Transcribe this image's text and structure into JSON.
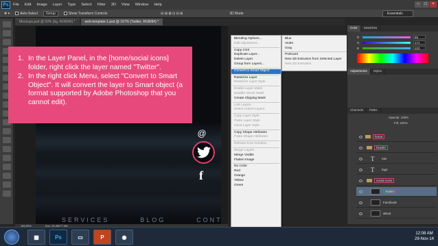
{
  "app": {
    "logo": "Ps"
  },
  "menubar": [
    "File",
    "Edit",
    "Image",
    "Layer",
    "Type",
    "Select",
    "Filter",
    "3D",
    "View",
    "Window",
    "Help"
  ],
  "options": {
    "auto_select": "Auto-Select",
    "group": "Group",
    "show_transform": "Show Transform Controls",
    "mode_3d": "3D Mode",
    "workspace": "Essentials"
  },
  "tabs": [
    {
      "label": "Mockups.psd @ 50% (bg, RGB/8#) *"
    },
    {
      "label": "web-template-1.psd @ 167% (Twitter, RGB/8#) *"
    }
  ],
  "instructions": [
    {
      "num": "1.",
      "text": "In the Layer Panel, in the [home/social icons] folder, right click the layer named \"Twitter\"."
    },
    {
      "num": "2.",
      "text": "In the right click Menu, select \"Convert to Smart Object\". It will convert the layer to Smart object (a format supported by Adobe Photoshop that you cannot edit)."
    }
  ],
  "artwork": {
    "nav": [
      "SERVICES",
      "BLOG",
      "CONTACT"
    ],
    "at_symbol": "@",
    "fb_letter": "f"
  },
  "context_menu": [
    {
      "label": "Blending Options...",
      "state": "normal"
    },
    {
      "label": "Edit Adjustment...",
      "state": "disabled"
    },
    {
      "sep": true
    },
    {
      "label": "Copy CSS",
      "state": "normal"
    },
    {
      "label": "Duplicate Layer...",
      "state": "normal"
    },
    {
      "label": "Delete Layer",
      "state": "normal"
    },
    {
      "label": "Group from Layers...",
      "state": "normal"
    },
    {
      "sep": true
    },
    {
      "label": "Convert to Smart Object",
      "state": "highlight"
    },
    {
      "sep": true
    },
    {
      "label": "Rasterize Layer",
      "state": "normal"
    },
    {
      "label": "Rasterize Layer Style",
      "state": "disabled"
    },
    {
      "sep": true
    },
    {
      "label": "Enable Layer Mask",
      "state": "disabled"
    },
    {
      "label": "Disable Vector Mask",
      "state": "disabled"
    },
    {
      "label": "Create Clipping Mask",
      "state": "normal"
    },
    {
      "sep": true
    },
    {
      "label": "Link Layers",
      "state": "disabled"
    },
    {
      "label": "Select Linked Layers",
      "state": "disabled"
    },
    {
      "sep": true
    },
    {
      "label": "Copy Layer Style",
      "state": "disabled"
    },
    {
      "label": "Paste Layer Style",
      "state": "disabled"
    },
    {
      "label": "Clear Layer Style",
      "state": "disabled"
    },
    {
      "sep": true
    },
    {
      "label": "Copy Shape Attributes",
      "state": "normal"
    },
    {
      "label": "Paste Shape Attributes",
      "state": "disabled"
    },
    {
      "sep": true
    },
    {
      "label": "Release from Isolation",
      "state": "disabled"
    },
    {
      "sep": true
    },
    {
      "label": "Merge Layers",
      "state": "disabled"
    },
    {
      "label": "Merge Visible",
      "state": "normal"
    },
    {
      "label": "Flatten Image",
      "state": "normal"
    },
    {
      "sep": true
    },
    {
      "label": "No Color",
      "state": "normal"
    },
    {
      "label": "Red",
      "state": "normal"
    },
    {
      "label": "Orange",
      "state": "normal"
    },
    {
      "label": "Yellow",
      "state": "normal"
    },
    {
      "label": "Green",
      "state": "normal"
    }
  ],
  "context_menu_2": [
    {
      "label": "Blue",
      "state": "normal"
    },
    {
      "label": "Violet",
      "state": "normal"
    },
    {
      "label": "Gray",
      "state": "normal"
    },
    {
      "sep": true
    },
    {
      "label": "Postcard",
      "state": "normal"
    },
    {
      "label": "New 3D Extrusion from Selected Layer",
      "state": "normal"
    },
    {
      "label": "New 3D Extrusion",
      "state": "disabled"
    }
  ],
  "panels": {
    "color_tabs": [
      "Color",
      "Swatches"
    ],
    "sliders": [
      {
        "label": "R",
        "value": "69"
      },
      {
        "label": "G",
        "value": "171"
      },
      {
        "label": "B",
        "value": "223"
      }
    ],
    "adjust_tabs": [
      "Adjustments",
      "Styles"
    ],
    "layer_tabs": [
      "Channels",
      "Paths"
    ],
    "opacity": "Opacity: 100%",
    "fill": "Fill: 100%"
  },
  "layers": [
    {
      "name": "home",
      "type": "folder",
      "selected": false
    },
    {
      "name": "header",
      "type": "folder",
      "selected": false
    },
    {
      "name": "nav",
      "type": "text",
      "selected": false
    },
    {
      "name": "logo",
      "type": "text",
      "selected": false
    },
    {
      "name": "social icons",
      "type": "folder",
      "selected": false
    },
    {
      "name": "Twitter",
      "type": "shape",
      "selected": true
    },
    {
      "name": "Facebook",
      "type": "shape",
      "selected": false
    },
    {
      "name": "about",
      "type": "shape",
      "selected": false
    }
  ],
  "statusbar": {
    "zoom": "166.99%",
    "doc": "Doc: 26.4M/77.4M"
  },
  "taskbar": {
    "apps": [
      "Ps",
      "",
      "",
      "P",
      ""
    ],
    "time": "12:08 AM",
    "date": "29-Nov-14"
  }
}
